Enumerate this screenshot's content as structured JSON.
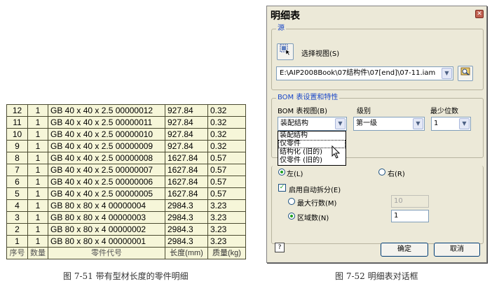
{
  "bom_table": {
    "rows": [
      [
        "12",
        "1",
        "GB 40 x 40 x 2.5 00000012",
        "927.84",
        "0.32"
      ],
      [
        "11",
        "1",
        "GB 40 x 40 x 2.5 00000011",
        "927.84",
        "0.32"
      ],
      [
        "10",
        "1",
        "GB 40 x 40 x 2.5 00000010",
        "927.84",
        "0.32"
      ],
      [
        "9",
        "1",
        "GB 40 x 40 x 2.5 00000009",
        "927.84",
        "0.32"
      ],
      [
        "8",
        "1",
        "GB 40 x 40 x 2.5 00000008",
        "1627.84",
        "0.57"
      ],
      [
        "7",
        "1",
        "GB 40 x 40 x 2.5 00000007",
        "1627.84",
        "0.57"
      ],
      [
        "6",
        "1",
        "GB 40 x 40 x 2.5 00000006",
        "1627.84",
        "0.57"
      ],
      [
        "5",
        "1",
        "GB 40 x 40 x 2.5 00000005",
        "1627.84",
        "0.57"
      ],
      [
        "4",
        "1",
        "GB 80 x 80 x 4 00000004",
        "2984.3",
        "3.23"
      ],
      [
        "3",
        "1",
        "GB 80 x 80 x 4 00000003",
        "2984.3",
        "3.23"
      ],
      [
        "2",
        "1",
        "GB 80 x 80 x 4 00000002",
        "2984.3",
        "3.23"
      ],
      [
        "1",
        "1",
        "GB 80 x 80 x 4 00000001",
        "2984.3",
        "3.23"
      ]
    ],
    "headers": [
      "序号",
      "数量",
      "零件代号",
      "长度(mm)",
      "质量(kg)"
    ]
  },
  "captions": {
    "left": "图 7-51 带有型材长度的零件明细",
    "right": "图 7-52  明细表对话框"
  },
  "dialog": {
    "title": "明细表",
    "close_glyph": "✕",
    "source": {
      "group_title": "源",
      "pick_view_label": "选择视图(S)",
      "path_value": "E:\\AIP2008Book\\07结构件\\07[end]\\07-11.iam"
    },
    "bom": {
      "group_title": "BOM 表设置和特性",
      "view_label": "BOM 表视图(B)",
      "level_label": "级别",
      "decimals_label": "最少位数",
      "view_value": "装配结构",
      "level_value": "第一级",
      "decimals_value": "1",
      "view_options": [
        "装配结构",
        "仅零件",
        "结构化 (旧的)",
        "仅零件 (旧的)"
      ]
    },
    "split": {
      "left_label": "左(L)",
      "right_label": "右(R)",
      "auto_split_label": "启用自动拆分(E)",
      "max_rows_label": "最大行数(M)",
      "max_rows_value": "10",
      "sections_label": "区域数(N)",
      "sections_value": "1"
    },
    "ok_label": "确定",
    "cancel_label": "取消",
    "help_glyph": "?"
  },
  "colors": {
    "table_bg": "#f6f6d9",
    "dialog_bg": "#ece9d8",
    "group_title": "#1a47c8"
  }
}
